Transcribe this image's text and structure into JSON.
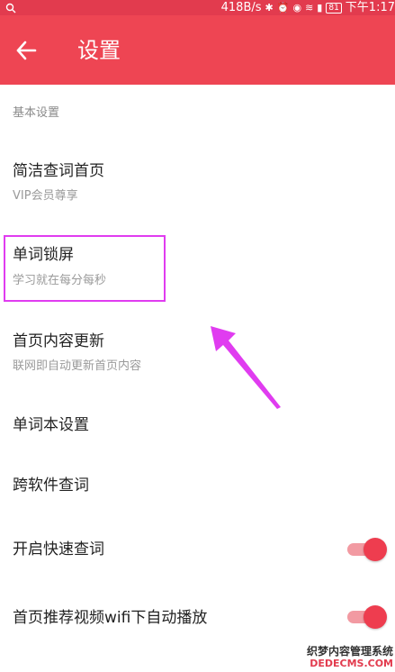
{
  "status_bar": {
    "left_icon": "search-icon",
    "speed": "418B/s",
    "battery": "81",
    "time": "下午1:17"
  },
  "header": {
    "title": "设置",
    "back_icon": "arrow-left-icon"
  },
  "section": {
    "label": "基本设置"
  },
  "items": [
    {
      "title": "简洁查词首页",
      "subtitle": "VIP会员尊享"
    },
    {
      "title": "单词锁屏",
      "subtitle": "学习就在每分每秒"
    },
    {
      "title": "首页内容更新",
      "subtitle": "联网即自动更新首页内容"
    },
    {
      "title": "单词本设置"
    },
    {
      "title": "跨软件查词"
    },
    {
      "title": "开启快速查词",
      "toggle": true
    },
    {
      "title": "首页推荐视频wifi下自动播放",
      "toggle": true
    }
  ],
  "watermark": {
    "line1": "织梦内容管理系统",
    "line2": "DEDECMS.COM"
  },
  "colors": {
    "accent": "#ee4553",
    "annotation": "#e03cf0"
  }
}
